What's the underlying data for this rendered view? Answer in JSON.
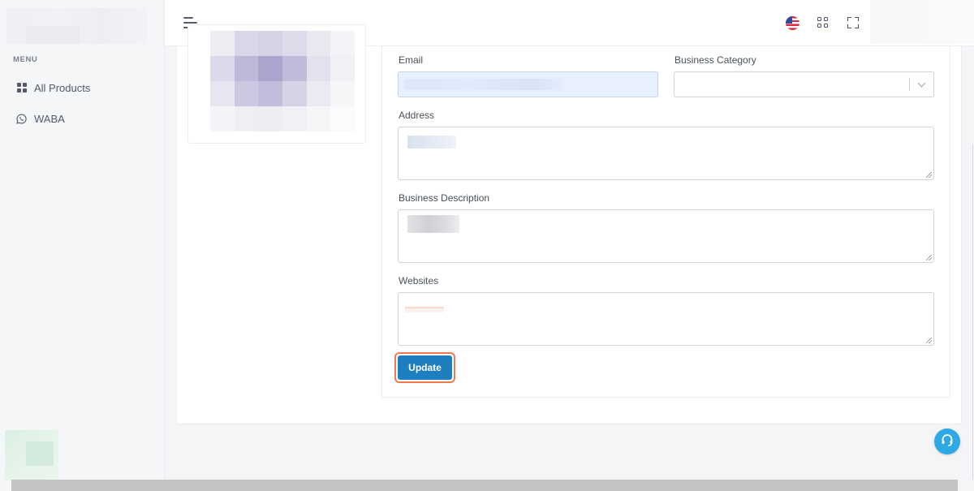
{
  "sidebar": {
    "menu_title": "MENU",
    "items": [
      {
        "label": "All Products",
        "icon": "grid-icon"
      },
      {
        "label": "WABA",
        "icon": "whatsapp-icon"
      }
    ]
  },
  "topbar": {
    "language_flag": "us-flag-icon"
  },
  "form": {
    "email_label": "Email",
    "business_category_label": "Business Category",
    "address_label": "Address",
    "business_description_label": "Business Description",
    "websites_label": "Websites",
    "update_label": "Update"
  },
  "colors": {
    "primary_button": "#1d7fbf",
    "highlight_outline": "#f07a4b",
    "support_button": "#2ea9e6",
    "email_autofill_bg": "#e8f0fe"
  }
}
